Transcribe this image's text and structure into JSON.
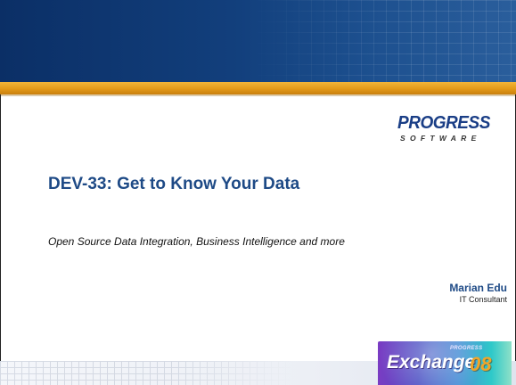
{
  "company_logo": {
    "main": "PROGRESS",
    "sub": "SOFTWARE"
  },
  "slide": {
    "title": "DEV-33: Get to Know Your Data",
    "subtitle": "Open Source Data Integration, Business Intelligence and more",
    "presenter_name": "Marian Edu",
    "presenter_role": "IT Consultant"
  },
  "event_logo": {
    "small": "PROGRESS",
    "word": "Exchange",
    "year": "08"
  },
  "colors": {
    "header": "#123f7c",
    "accent_gold": "#e39a18",
    "title_blue": "#1e4a86"
  }
}
